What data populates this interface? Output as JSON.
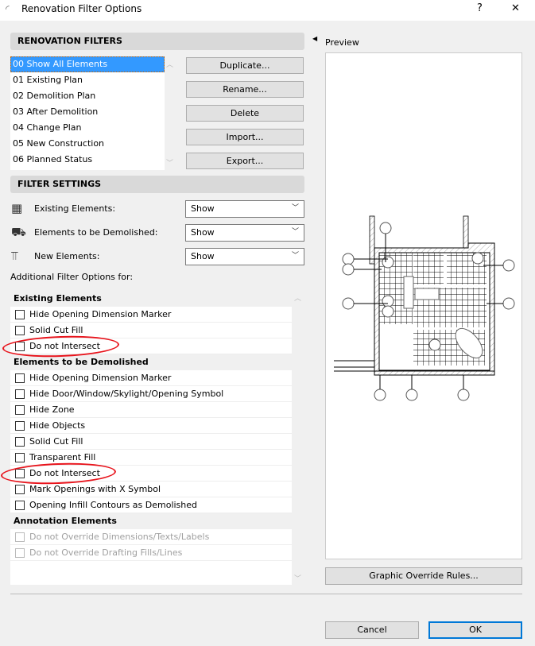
{
  "window": {
    "title": "Renovation Filter Options",
    "help": "?",
    "close": "✕"
  },
  "renovation_filters": {
    "header": "RENOVATION FILTERS",
    "items": [
      "00 Show All Elements",
      "01 Existing Plan",
      "02 Demolition Plan",
      "03 After Demolition",
      "04 Change Plan",
      "05 New Construction",
      "06 Planned Status"
    ],
    "selected_index": 0,
    "buttons": {
      "duplicate": "Duplicate...",
      "rename": "Rename...",
      "delete": "Delete",
      "import": "Import...",
      "export": "Export..."
    }
  },
  "filter_settings": {
    "header": "FILTER SETTINGS",
    "rows": [
      {
        "label": "Existing Elements:",
        "value": "Show",
        "icon": "brick-wall-icon"
      },
      {
        "label": "Elements to be Demolished:",
        "value": "Show",
        "icon": "bulldozer-icon"
      },
      {
        "label": "New Elements:",
        "value": "Show",
        "icon": "crane-icon"
      }
    ]
  },
  "additional": {
    "label": "Additional Filter Options for:",
    "groups": [
      {
        "title": "Existing Elements",
        "options": [
          {
            "label": "Hide Opening Dimension Marker",
            "checked": false
          },
          {
            "label": "Solid Cut Fill",
            "checked": false
          },
          {
            "label": "Do not Intersect",
            "checked": false,
            "highlighted": true
          }
        ]
      },
      {
        "title": "Elements to be Demolished",
        "options": [
          {
            "label": "Hide Opening Dimension Marker",
            "checked": false
          },
          {
            "label": "Hide Door/Window/Skylight/Opening Symbol",
            "checked": false
          },
          {
            "label": "Hide Zone",
            "checked": false
          },
          {
            "label": "Hide Objects",
            "checked": false
          },
          {
            "label": "Solid Cut Fill",
            "checked": false
          },
          {
            "label": "Transparent Fill",
            "checked": false
          },
          {
            "label": "Do not Intersect",
            "checked": false,
            "highlighted": true
          },
          {
            "label": "Mark Openings with X Symbol",
            "checked": false
          },
          {
            "label": "Opening Infill Contours as Demolished",
            "checked": false
          }
        ]
      },
      {
        "title": "Annotation Elements",
        "options": [
          {
            "label": "Do not Override Dimensions/Texts/Labels",
            "checked": false,
            "disabled": true
          },
          {
            "label": "Do not Override Drafting Fills/Lines",
            "checked": false,
            "disabled": true
          }
        ]
      }
    ]
  },
  "preview": {
    "label": "Preview",
    "override_button": "Graphic Override Rules..."
  },
  "footer": {
    "cancel": "Cancel",
    "ok": "OK"
  },
  "colors": {
    "selection": "#3399ff",
    "highlight_ellipse": "#e8141c",
    "ok_border": "#0078d7"
  }
}
